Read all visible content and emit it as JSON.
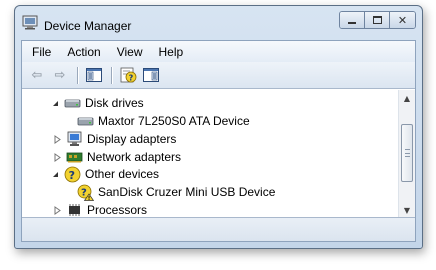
{
  "window": {
    "title": "Device Manager",
    "icon": "device-manager-icon",
    "controls": {
      "minimize_icon": "minimize-icon",
      "maximize_icon": "maximize-icon",
      "close_icon": "close-icon",
      "close_glyph": "✕"
    }
  },
  "menu": [
    "File",
    "Action",
    "View",
    "Help"
  ],
  "toolbar": {
    "buttons": [
      {
        "icon": "back-arrow-icon",
        "glyph": "⇦",
        "enabled": false
      },
      {
        "icon": "forward-arrow-icon",
        "glyph": "⇨",
        "enabled": false
      },
      {
        "icon": "show-hide-console-tree-icon"
      },
      {
        "icon": "properties-help-icon"
      },
      {
        "icon": "show-action-pane-icon"
      }
    ]
  },
  "tree": {
    "items": [
      {
        "label": "Disk drives",
        "icon": "disk-drive-icon",
        "expanded": true
      },
      {
        "label": "Maxtor 7L250S0 ATA Device",
        "icon": "hard-disk-icon",
        "child": true
      },
      {
        "label": "Display adapters",
        "icon": "display-adapter-icon",
        "expanded": false
      },
      {
        "label": "Network adapters",
        "icon": "network-adapter-icon",
        "expanded": false
      },
      {
        "label": "Other devices",
        "icon": "unknown-device-icon",
        "expanded": true
      },
      {
        "label": "SanDisk Cruzer Mini USB Device",
        "icon": "unknown-device-warning-icon",
        "child": true
      },
      {
        "label": "Processors",
        "icon": "processor-icon",
        "expanded": false
      }
    ]
  },
  "scrollbar": {
    "up_glyph": "▲",
    "down_glyph": "▼"
  },
  "colors": {
    "title_bar": "#c9d9ec",
    "selection_accent": "#3399ff",
    "warning_yellow": "#f2d230"
  }
}
